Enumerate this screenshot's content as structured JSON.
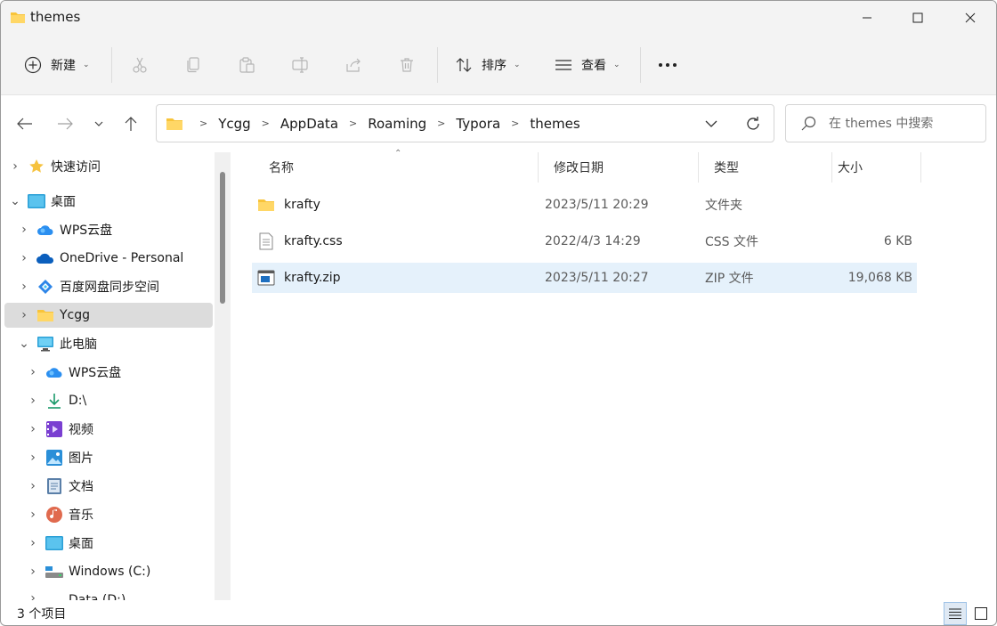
{
  "window": {
    "title": "themes"
  },
  "commandbar": {
    "new_label": "新建",
    "sort_label": "排序",
    "view_label": "查看",
    "icons": [
      "plus-circle-icon",
      "scissors-icon",
      "copy-icon",
      "paste-icon",
      "rename-icon",
      "share-icon",
      "trash-icon",
      "sort-icon",
      "view-list-icon",
      "more-icon"
    ]
  },
  "address": {
    "crumbs": [
      "Ycgg",
      "AppData",
      "Roaming",
      "Typora",
      "themes"
    ],
    "search_placeholder": "在 themes 中搜索"
  },
  "sidebar": {
    "items": [
      {
        "label": "快速访问",
        "icon": "star-icon",
        "indent": 0
      },
      {
        "label": "桌面",
        "icon": "desktop-icon",
        "indent": 0
      },
      {
        "label": "WPS云盘",
        "icon": "cloud-wps-icon",
        "indent": 1
      },
      {
        "label": "OneDrive - Personal",
        "icon": "onedrive-icon",
        "indent": 1
      },
      {
        "label": "百度网盘同步空间",
        "icon": "baidu-icon",
        "indent": 1
      },
      {
        "label": "Ycgg",
        "icon": "folder-icon",
        "indent": 1
      },
      {
        "label": "此电脑",
        "icon": "pc-icon",
        "indent": 1
      },
      {
        "label": "WPS云盘",
        "icon": "cloud-wps-icon",
        "indent": 2
      },
      {
        "label": "D:\\",
        "icon": "download-icon",
        "indent": 2
      },
      {
        "label": "视频",
        "icon": "video-icon",
        "indent": 2
      },
      {
        "label": "图片",
        "icon": "pictures-icon",
        "indent": 2
      },
      {
        "label": "文档",
        "icon": "documents-icon",
        "indent": 2
      },
      {
        "label": "音乐",
        "icon": "music-icon",
        "indent": 2
      },
      {
        "label": "桌面",
        "icon": "desktop-icon",
        "indent": 2
      },
      {
        "label": "Windows (C:)",
        "icon": "drive-icon",
        "indent": 2
      },
      {
        "label": "Data (D:)",
        "icon": "drive-icon",
        "indent": 2
      }
    ]
  },
  "filelist": {
    "headers": {
      "name": "名称",
      "date": "修改日期",
      "type": "类型",
      "size": "大小"
    },
    "files": [
      {
        "name": "krafty",
        "date": "2023/5/11 20:29",
        "type": "文件夹",
        "size": "",
        "icon": "folder-icon"
      },
      {
        "name": "krafty.css",
        "date": "2022/4/3 14:29",
        "type": "CSS 文件",
        "size": "6 KB",
        "icon": "css-file-icon"
      },
      {
        "name": "krafty.zip",
        "date": "2023/5/11 20:27",
        "type": "ZIP 文件",
        "size": "19,068 KB",
        "icon": "zip-file-icon"
      }
    ]
  },
  "status": {
    "item_count": "3 个项目"
  },
  "colors": {
    "accent": "#0067c0",
    "selected_row": "#e5f1fb",
    "folder": "#f8c43a"
  }
}
